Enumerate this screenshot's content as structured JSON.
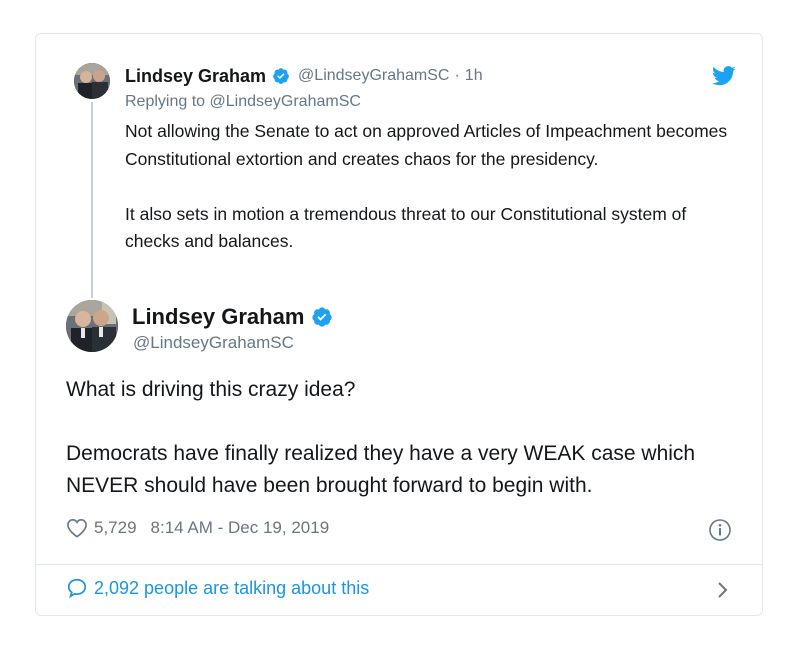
{
  "parent_tweet": {
    "author_name": "Lindsey Graham",
    "handle": "@LindseyGrahamSC",
    "separator": "·",
    "time_ago": "1h",
    "replying_label": "Replying to",
    "replying_handle": "@LindseyGrahamSC",
    "paragraphs": [
      "Not allowing the Senate to act on approved Articles of Impeachment becomes Constitutional extortion and creates chaos for the presidency.",
      "It also sets in motion a tremendous threat to our Constitutional system of checks and balances."
    ]
  },
  "main_tweet": {
    "author_name": "Lindsey Graham",
    "handle": "@LindseyGrahamSC",
    "paragraphs": [
      "What is driving this crazy idea?",
      "Democrats have finally realized they have a very WEAK case which NEVER should have been brought forward to begin with."
    ],
    "like_count": "5,729",
    "timestamp": "8:14 AM - Dec 19, 2019"
  },
  "footer": {
    "talking_text": "2,092 people are talking about this"
  },
  "icons": {
    "verified": "verified-badge-icon",
    "brand": "twitter-bird-icon",
    "like": "heart-icon",
    "info": "info-icon",
    "conversation": "speech-bubble-icon",
    "chevron": "chevron-right-icon"
  },
  "colors": {
    "brand_blue": "#1da1f2",
    "link_blue": "#1b95e0",
    "secondary_text": "#657786",
    "primary_text": "#14171a",
    "border": "#e1e8ed"
  }
}
